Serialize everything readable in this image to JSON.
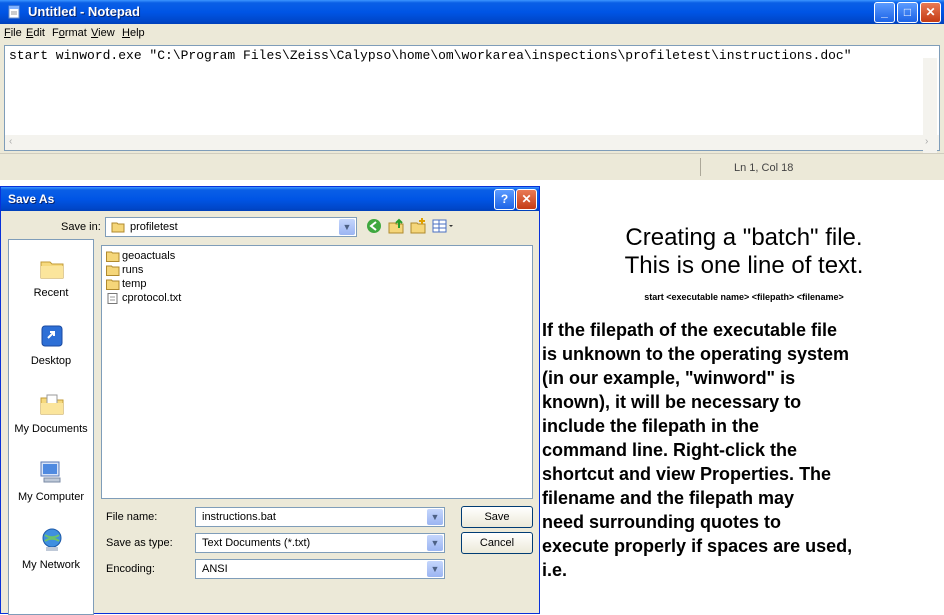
{
  "notepad": {
    "title": "Untitled - Notepad",
    "menu": [
      "File",
      "Edit",
      "Format",
      "View",
      "Help"
    ],
    "menu_accel": [
      "F",
      "E",
      "o",
      "V",
      "H"
    ],
    "text": "start winword.exe \"C:\\Program Files\\Zeiss\\Calypso\\home\\om\\workarea\\inspections\\profiletest\\instructions.doc\"",
    "status": "Ln 1, Col 18"
  },
  "save_as": {
    "title": "Save As",
    "save_in_label": "Save in:",
    "save_in_value": "profiletest",
    "places": [
      "Recent",
      "Desktop",
      "My Documents",
      "My Computer",
      "My Network"
    ],
    "files": [
      {
        "name": "geoactuals",
        "type": "folder"
      },
      {
        "name": "runs",
        "type": "folder"
      },
      {
        "name": "temp",
        "type": "folder"
      },
      {
        "name": "cprotocol.txt",
        "type": "text-file"
      }
    ],
    "file_name_label": "File name:",
    "file_name_value": "instructions.bat",
    "save_as_type_label": "Save as type:",
    "save_as_type_value": "Text Documents (*.txt)",
    "encoding_label": "Encoding:",
    "encoding_value": "ANSI",
    "save_button": "Save",
    "cancel_button": "Cancel"
  },
  "instructions": {
    "heading_line1": "Creating a \"batch\" file.",
    "heading_line2": "This is one line of text.",
    "syntax": "start <executable name> <filepath> <filename>",
    "body": "If the filepath of the executable file\nis unknown to the operating system\n(in our example, \"winword\" is\nknown), it will be necessary to\ninclude the filepath in the\ncommand line. Right-click the\nshortcut and view Properties. The\nfilename and the filepath may\nneed surrounding quotes to\nexecute properly if spaces are used,\ni.e."
  },
  "colors": {
    "titlebar": "#0055e5",
    "dialog_bg": "#ece9d8",
    "field_border": "#7f9db9"
  }
}
